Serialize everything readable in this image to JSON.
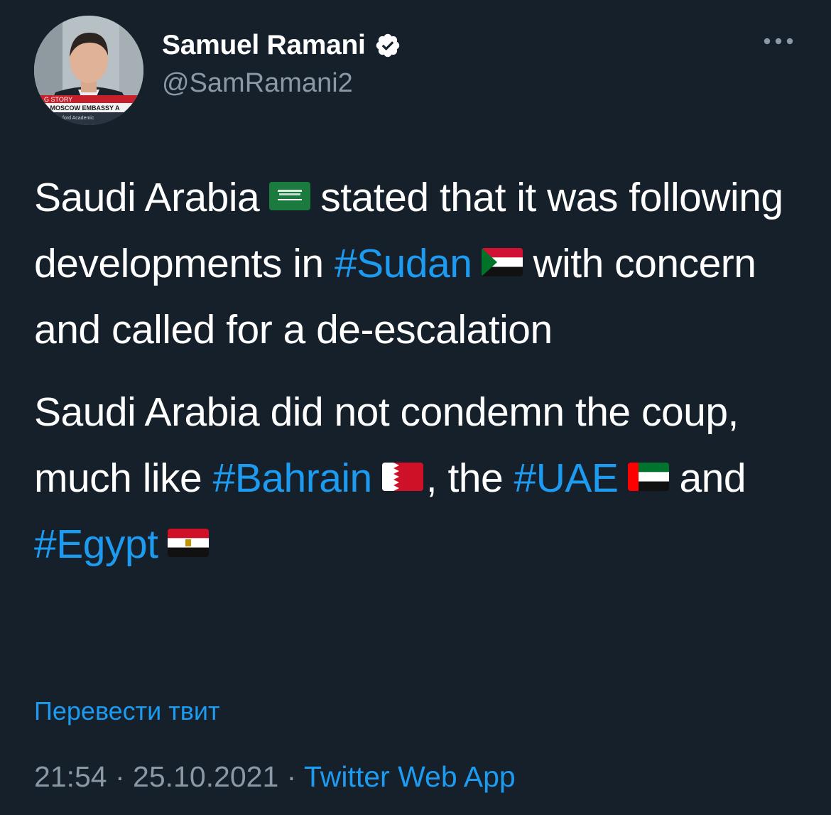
{
  "author": {
    "display_name": "Samuel Ramani",
    "handle": "@SamRamani2",
    "verified_icon": "verified-badge-icon",
    "avatar_caption_lines": [
      "G STORY",
      "S MOSCOW EMBASSY A",
      "ford Academic"
    ]
  },
  "menu": {
    "icon": "more-horizontal-icon"
  },
  "tweet": {
    "p1": {
      "t1": "Saudi Arabia",
      "t2": "stated that it was following developments in",
      "tag1": "#Sudan",
      "t3": "with concern and called for a de-escalation"
    },
    "p2": {
      "t1": "Saudi Arabia did not condemn the coup, much like",
      "tag1": "#Bahrain",
      "t2": ", the",
      "tag2": "#UAE",
      "t3": "and",
      "tag3": "#Egypt"
    },
    "flags": {
      "saudi": "flag-saudi-arabia-icon",
      "sudan": "flag-sudan-icon",
      "bahrain": "flag-bahrain-icon",
      "uae": "flag-uae-icon",
      "egypt": "flag-egypt-icon"
    }
  },
  "translate_label": "Перевести твит",
  "meta": {
    "time": "21:54",
    "sep1": " · ",
    "date": "25.10.2021",
    "sep2": " · ",
    "source": "Twitter Web App"
  },
  "colors": {
    "background": "#15202b",
    "text": "#ffffff",
    "secondary": "#8b98a5",
    "link": "#1d9bf0"
  }
}
